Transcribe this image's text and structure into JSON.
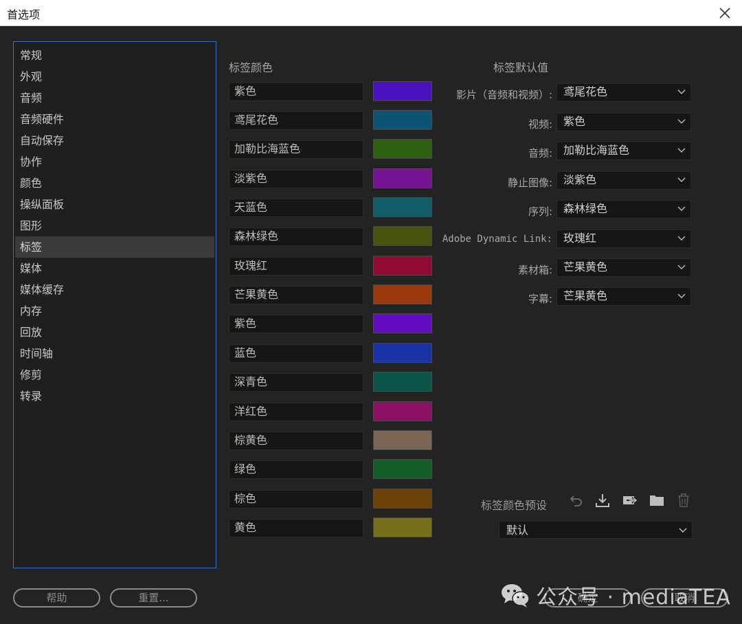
{
  "window": {
    "title": "首选项"
  },
  "sidebar": {
    "items": [
      {
        "label": "常规"
      },
      {
        "label": "外观"
      },
      {
        "label": "音频"
      },
      {
        "label": "音频硬件"
      },
      {
        "label": "自动保存"
      },
      {
        "label": "协作"
      },
      {
        "label": "颜色"
      },
      {
        "label": "操纵面板"
      },
      {
        "label": "图形"
      },
      {
        "label": "标签"
      },
      {
        "label": "媒体"
      },
      {
        "label": "媒体缓存"
      },
      {
        "label": "内存"
      },
      {
        "label": "回放"
      },
      {
        "label": "时间轴"
      },
      {
        "label": "修剪"
      },
      {
        "label": "转录"
      }
    ],
    "selected": "标签"
  },
  "label_colors": {
    "title": "标签颜色",
    "items": [
      {
        "name": "紫色",
        "color": "#4c12c2"
      },
      {
        "name": "鸢尾花色",
        "color": "#0b5473"
      },
      {
        "name": "加勒比海蓝色",
        "color": "#2f6012"
      },
      {
        "name": "淡紫色",
        "color": "#751593"
      },
      {
        "name": "天蓝色",
        "color": "#105c68"
      },
      {
        "name": "森林绿色",
        "color": "#4a520f"
      },
      {
        "name": "玫瑰红",
        "color": "#910b35"
      },
      {
        "name": "芒果黄色",
        "color": "#9a3a0c"
      },
      {
        "name": "紫色",
        "color": "#610cc0"
      },
      {
        "name": "蓝色",
        "color": "#1a32a5"
      },
      {
        "name": "深青色",
        "color": "#0c5447"
      },
      {
        "name": "洋红色",
        "color": "#8a1164"
      },
      {
        "name": "棕黄色",
        "color": "#7b6555"
      },
      {
        "name": "绿色",
        "color": "#145e28"
      },
      {
        "name": "棕色",
        "color": "#6b420a"
      },
      {
        "name": "黄色",
        "color": "#77701a"
      }
    ]
  },
  "label_defaults": {
    "title": "标签默认值",
    "items": [
      {
        "label": "影片（音频和视频）:",
        "value": "鸢尾花色"
      },
      {
        "label": "视频:",
        "value": "紫色"
      },
      {
        "label": "音频:",
        "value": "加勒比海蓝色"
      },
      {
        "label": "静止图像:",
        "value": "淡紫色"
      },
      {
        "label": "序列:",
        "value": "森林绿色"
      },
      {
        "label": "Adobe Dynamic Link:",
        "value": "玫瑰红"
      },
      {
        "label": "素材箱:",
        "value": "芒果黄色"
      },
      {
        "label": "字幕:",
        "value": "芒果黄色"
      }
    ]
  },
  "preset": {
    "label": "标签颜色预设",
    "value": "默认",
    "icons": [
      "undo-icon",
      "import-icon",
      "export-icon",
      "folder-icon",
      "trash-icon"
    ]
  },
  "buttons": {
    "help": "帮助",
    "reset": "重置...",
    "ok": "确定",
    "cancel": "取消"
  },
  "watermark": {
    "text": "公众号 · mediaTEA"
  }
}
